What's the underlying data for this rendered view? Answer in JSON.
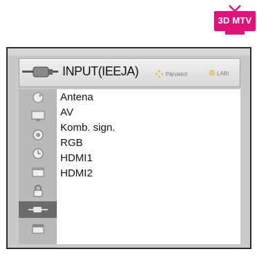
{
  "badge": {
    "label": "3D MTV",
    "color": "#e0127a"
  },
  "menu": {
    "title": "INPUT(IEEJA)",
    "hint_move": "Pārvietot",
    "hint_ok": "LABI",
    "sidebar_icons": [
      "satellite-dish-icon",
      "monitor-icon",
      "speaker-icon",
      "clock-icon",
      "calendar-icon",
      "lock-icon",
      "input-plug-icon",
      "clapper-icon"
    ],
    "active_sidebar_index": 6,
    "items": [
      "Antena",
      "AV",
      "Komb. sign.",
      "RGB",
      "HDMI1",
      "HDMI2"
    ]
  }
}
